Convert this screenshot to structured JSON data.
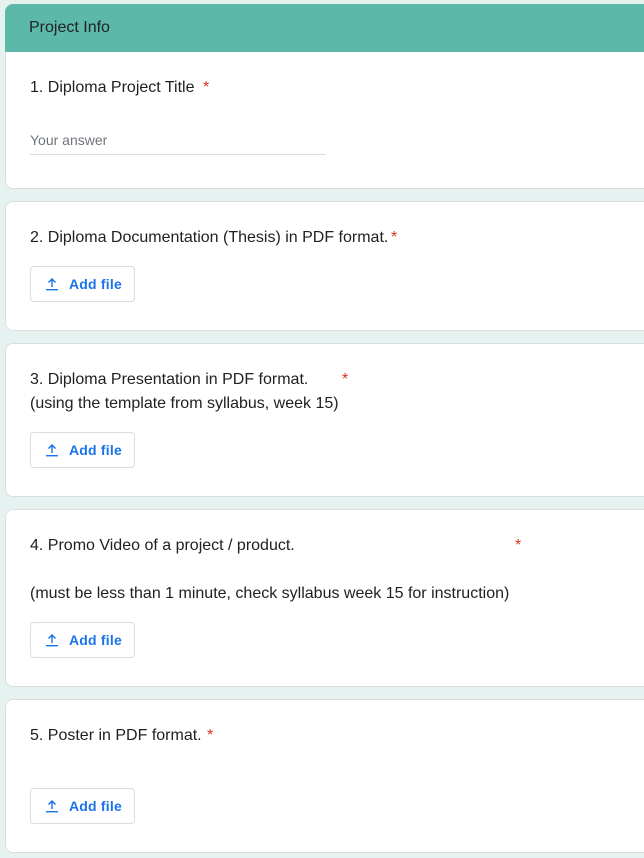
{
  "section": {
    "title": "Project Info"
  },
  "questions": [
    {
      "text": "1. Diploma Project Title",
      "required_mark": "*",
      "input_placeholder": "Your answer"
    },
    {
      "text": "2. Diploma Documentation (Thesis) in PDF format.",
      "required_mark": "*",
      "button_label": "Add file"
    },
    {
      "text": "3. Diploma Presentation in PDF format.",
      "subtext": "(using the template from syllabus, week 15)",
      "required_mark": "*",
      "button_label": "Add file"
    },
    {
      "text": "4. Promo Video of a project / product.",
      "subtext": "(must be less than 1 minute, check syllabus week 15 for instruction)",
      "required_mark": "*",
      "button_label": "Add file"
    },
    {
      "text": "5. Poster in PDF format.",
      "required_mark": "*",
      "button_label": "Add file"
    }
  ],
  "icons": {
    "upload": "upload-icon"
  },
  "colors": {
    "header_bg": "#5cb8a8",
    "required": "#d93025",
    "link_blue": "#1a73e8",
    "page_bg": "#e6f2ef"
  }
}
